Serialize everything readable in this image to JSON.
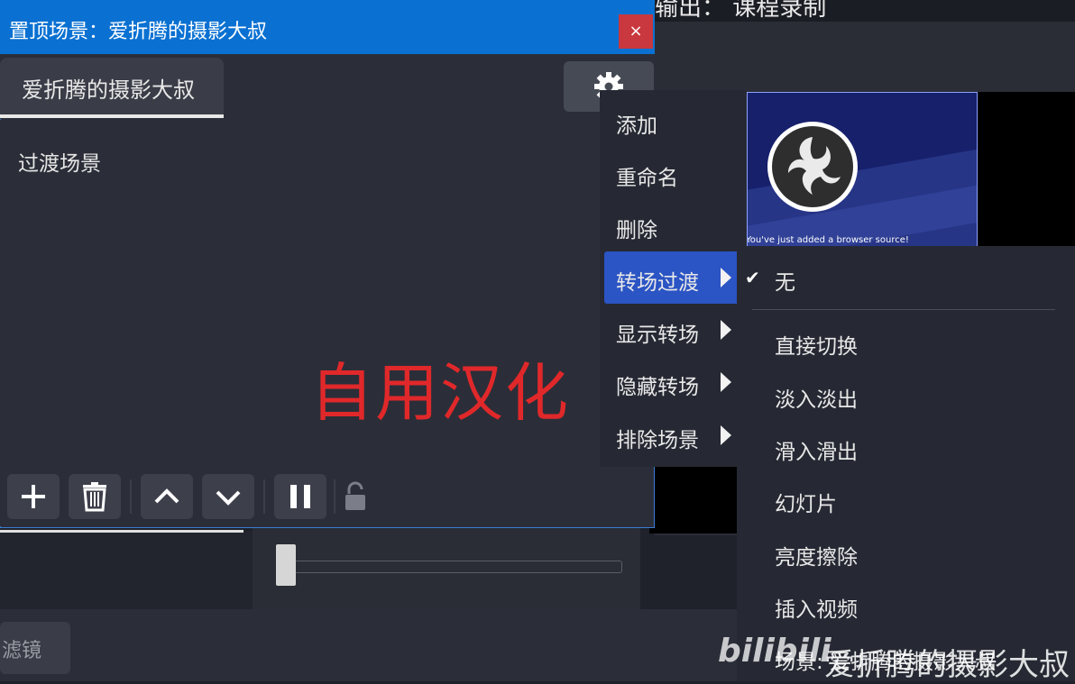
{
  "background": {
    "output_title": "输出： 课程录制",
    "preview_caption": "You've just added a browser source!",
    "filter_button_label": "滤镜"
  },
  "dialog": {
    "title": "置顶场景：爱折腾的摄影大叔",
    "close_label": "×",
    "scene_tab_label": "爱折腾的摄影大叔",
    "gear_icon": "gear-icon",
    "list_items": [
      "过渡场景"
    ],
    "overlay_text": "自用汉化",
    "toolbar": {
      "add_icon": "plus-icon",
      "delete_icon": "trash-icon",
      "up_icon": "chevron-up-icon",
      "down_icon": "chevron-down-icon",
      "pause_icon": "pause-icon",
      "lock_icon": "lock-icon"
    }
  },
  "context_menu": {
    "items": [
      {
        "label": "添加",
        "has_submenu": false
      },
      {
        "label": "重命名",
        "has_submenu": false
      },
      {
        "label": "删除",
        "has_submenu": false
      },
      {
        "label": "转场过渡",
        "has_submenu": true,
        "highlighted": true
      },
      {
        "label": "显示转场",
        "has_submenu": true
      },
      {
        "label": "隐藏转场",
        "has_submenu": true
      },
      {
        "label": "排除场景",
        "has_submenu": true
      }
    ]
  },
  "submenu": {
    "checked_item": "无",
    "items": [
      "直接切换",
      "淡入淡出",
      "滑入滑出",
      "幻灯片",
      "亮度擦除",
      "插入视频",
      "场景: 爱折腾的摄影大叔"
    ]
  },
  "watermark": {
    "bili": "bilibili",
    "channel": "爱折腾的摄影大叔"
  },
  "colors": {
    "titlebar": "#0a71d2",
    "close": "#c8383e",
    "menu_highlight": "#2b54c4",
    "overlay_red": "#e0282a"
  }
}
